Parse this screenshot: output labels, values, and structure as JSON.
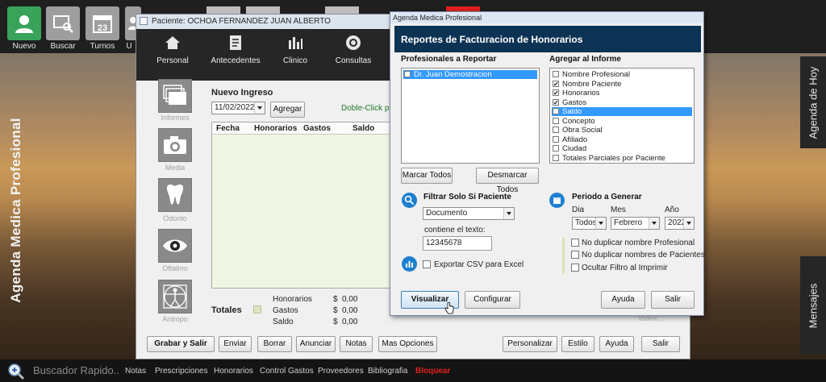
{
  "app": {
    "brand": "Agenda Medica Profesional",
    "right_tabs": {
      "agenda_hoy": "Agenda de Hoy",
      "mensajes": "Mensajes"
    }
  },
  "toolbar": {
    "items": [
      {
        "label": "Nuevo",
        "icon": "person-icon"
      },
      {
        "label": "Buscar",
        "icon": "search-icon"
      },
      {
        "label": "Turnos",
        "icon": "calendar-icon",
        "badge": "23"
      },
      {
        "label": "U",
        "icon": "people-icon"
      }
    ]
  },
  "bottom_bar": {
    "search_placeholder": "Buscador Rapido..",
    "links": [
      "Notas",
      "Prescripciones",
      "Honorarios",
      "Control Gastos",
      "Proveedores",
      "Bibliografia"
    ],
    "lock": "Bloquear"
  },
  "main_window": {
    "title": "Paciente: OCHOA FERNANDEZ JUAN ALBERTO",
    "nav": [
      "Personal",
      "Antecedentes",
      "Clinico",
      "Consultas"
    ],
    "side": [
      "Informes",
      "Media",
      "Odonto",
      "Oftalmo",
      "Antropo"
    ],
    "new_entry": {
      "title": "Nuevo Ingreso",
      "date": "11/02/2022",
      "add_button": "Agregar",
      "hint": "Doble-Click para"
    },
    "table": {
      "headers": [
        "Fecha",
        "Honorarios",
        "Gastos",
        "Saldo"
      ]
    },
    "totals": {
      "label": "Totales",
      "rows": [
        {
          "name": "Honorarios",
          "currency": "$",
          "value": "0,00"
        },
        {
          "name": "Gastos",
          "currency": "$",
          "value": "0,00"
        },
        {
          "name": "Saldo",
          "currency": "$",
          "value": "0,00"
        }
      ]
    },
    "faded_text": "Vadem...",
    "buttons": {
      "grabar": "Grabar y Salir",
      "enviar": "Enviar",
      "borrar": "Borrar",
      "anunciar": "Anunciar",
      "notas": "Notas",
      "mas_opciones": "Mas Opciones",
      "personalizar": "Personalizar",
      "estilo": "Estilo",
      "ayuda": "Ayuda",
      "salir": "Salir"
    }
  },
  "dialog": {
    "window_title": "Agenda Medica Profesional",
    "header": "Reportes de Facturacion de Honorarios",
    "profesionales": {
      "title": "Profesionales a Reportar",
      "items": [
        {
          "label": "Dr. Juan Demostracion",
          "checked": true,
          "selected": true
        }
      ],
      "mark_all": "Marcar Todos",
      "unmark_all": "Desmarcar Todos"
    },
    "agregar": {
      "title": "Agregar al Informe",
      "items": [
        {
          "label": "Nombre Profesional",
          "checked": false
        },
        {
          "label": "Nombre Paciente",
          "checked": true
        },
        {
          "label": "Honorarios",
          "checked": true
        },
        {
          "label": "Gastos",
          "checked": true
        },
        {
          "label": "Saldo",
          "checked": true,
          "selected": true
        },
        {
          "label": "Concepto",
          "checked": false
        },
        {
          "label": "Obra Social",
          "checked": false
        },
        {
          "label": "Afiliado",
          "checked": false
        },
        {
          "label": "Ciudad",
          "checked": false
        },
        {
          "label": "Totales Parciales por Paciente",
          "checked": false
        }
      ]
    },
    "filtro": {
      "title": "Filtrar Solo Si Paciente",
      "field": "Documento",
      "contains_label": "contiene el texto:",
      "text": "12345678"
    },
    "export_csv": "Exportar CSV para Excel",
    "periodo": {
      "title": "Periodo a Generar",
      "dia_label": "Dia",
      "mes_label": "Mes",
      "anio_label": "Año",
      "dia": "Todos",
      "mes": "Febrero",
      "anio": "2022"
    },
    "options": [
      "No duplicar nombre Profesional",
      "No duplicar nombres de Pacientes",
      "Ocultar Filtro al Imprimir"
    ],
    "buttons": {
      "visualizar": "Visualizar",
      "configurar": "Configurar",
      "ayuda": "Ayuda",
      "salir": "Salir"
    }
  },
  "colors": {
    "header_navy": "#0d3354",
    "selection_blue": "#3399ff",
    "lock_red": "#e02020",
    "nuevo_green": "#3aa35a"
  }
}
